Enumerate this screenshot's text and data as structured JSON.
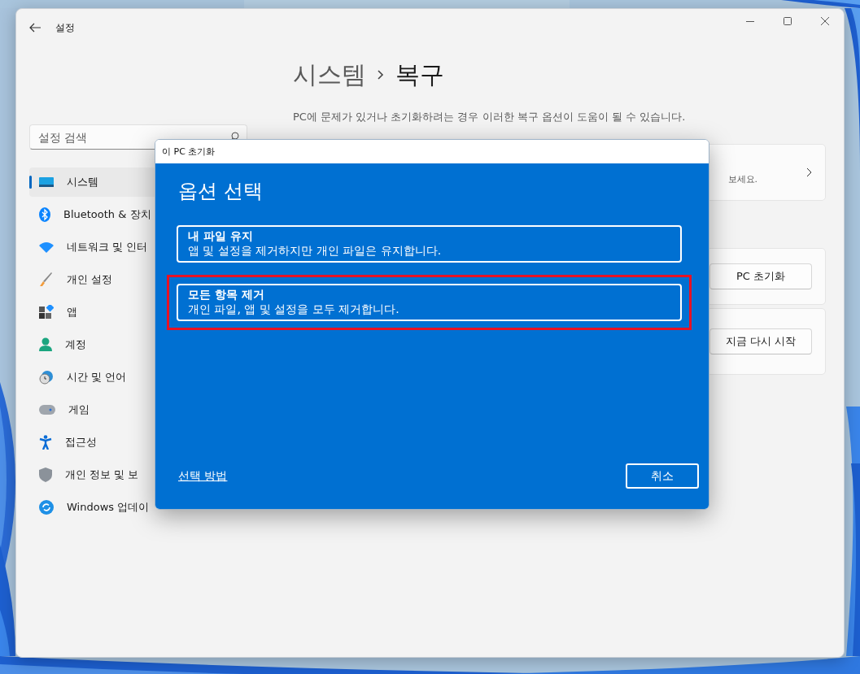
{
  "window": {
    "title": "설정"
  },
  "search": {
    "placeholder": "설정 검색"
  },
  "sidebar": {
    "items": [
      {
        "label": "시스템",
        "selected": true
      },
      {
        "label": "Bluetooth & 장치",
        "selected": false
      },
      {
        "label": "네트워크 및 인터",
        "selected": false
      },
      {
        "label": "개인 설정",
        "selected": false
      },
      {
        "label": "앱",
        "selected": false
      },
      {
        "label": "계정",
        "selected": false
      },
      {
        "label": "시간 및 언어",
        "selected": false
      },
      {
        "label": "게임",
        "selected": false
      },
      {
        "label": "접근성",
        "selected": false
      },
      {
        "label": "개인 정보 및 보",
        "selected": false
      },
      {
        "label": "Windows 업데이",
        "selected": false
      }
    ]
  },
  "page": {
    "breadcrumb": [
      "시스템",
      "복구"
    ],
    "description": "PC에 문제가 있거나 초기화하려는 경우 이러한 복구 옵션이 도움이 될 수 있습니다."
  },
  "cards": [
    {
      "kind": "link",
      "text": "보세요."
    },
    {
      "kind": "button",
      "button": "PC 초기화"
    },
    {
      "kind": "button",
      "button": "지금 다시 시작"
    }
  ],
  "dialog": {
    "title": "이 PC 초기화",
    "heading": "옵션 선택",
    "options": [
      {
        "title": "내 파일 유지",
        "description": "앱 및 설정을 제거하지만 개인 파일은 유지합니다.",
        "highlighted": false
      },
      {
        "title": "모든 항목 제거",
        "description": "개인 파일, 앱 및 설정을 모두 제거합니다.",
        "highlighted": true
      }
    ],
    "help_link": "선택 방법",
    "cancel": "취소"
  }
}
